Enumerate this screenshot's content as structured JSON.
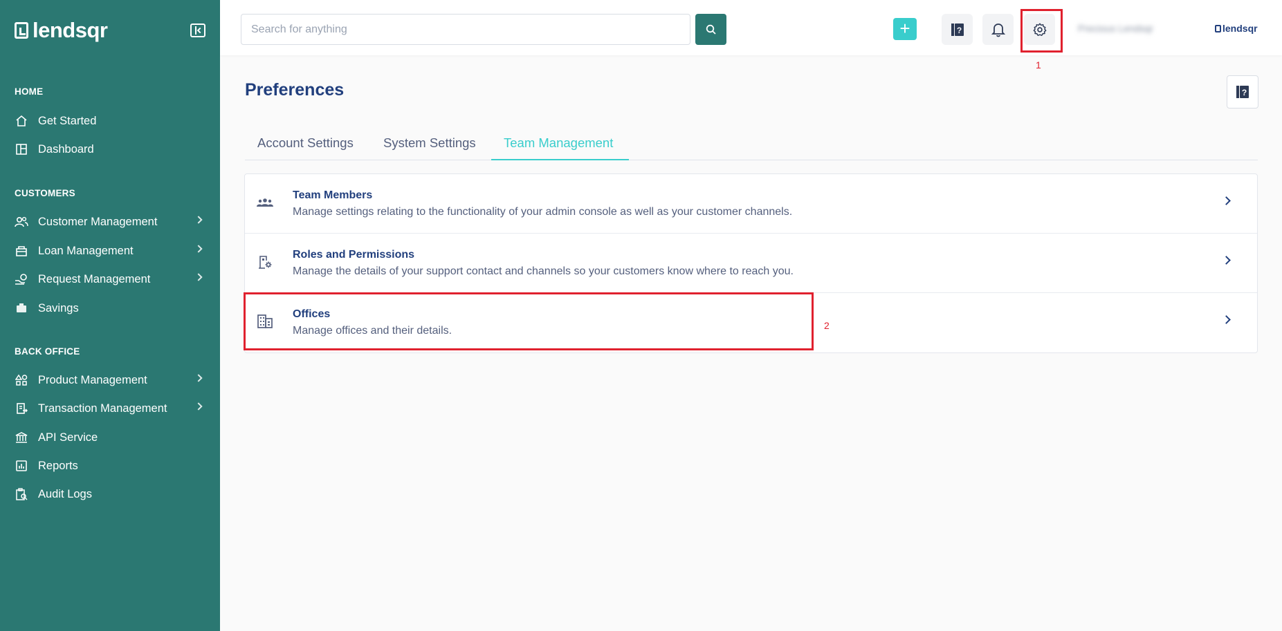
{
  "brand": {
    "logo_text": "lendsqr",
    "small_logo_text": "lendsqr"
  },
  "search": {
    "placeholder": "Search for anything"
  },
  "topbar": {
    "add_label": "+",
    "user_name": "Precious Lendsqr"
  },
  "sidebar": {
    "sections": [
      {
        "title": "HOME",
        "items": [
          {
            "label": "Get Started",
            "icon": "home-icon",
            "has_submenu": false
          },
          {
            "label": "Dashboard",
            "icon": "dashboard-icon",
            "has_submenu": false
          }
        ]
      },
      {
        "title": "CUSTOMERS",
        "items": [
          {
            "label": "Customer Management",
            "icon": "users-icon",
            "has_submenu": true
          },
          {
            "label": "Loan Management",
            "icon": "loan-icon",
            "has_submenu": true
          },
          {
            "label": "Request Management",
            "icon": "request-icon",
            "has_submenu": true
          },
          {
            "label": "Savings",
            "icon": "savings-icon",
            "has_submenu": false
          }
        ]
      },
      {
        "title": "BACK OFFICE",
        "items": [
          {
            "label": "Product Management",
            "icon": "shapes-icon",
            "has_submenu": true
          },
          {
            "label": "Transaction Management",
            "icon": "transaction-icon",
            "has_submenu": true
          },
          {
            "label": "API Service",
            "icon": "bank-icon",
            "has_submenu": false
          },
          {
            "label": "Reports",
            "icon": "chart-icon",
            "has_submenu": false
          },
          {
            "label": "Audit Logs",
            "icon": "clipboard-search-icon",
            "has_submenu": false
          }
        ]
      }
    ]
  },
  "page": {
    "title": "Preferences",
    "tabs": [
      {
        "label": "Account Settings",
        "active": false
      },
      {
        "label": "System Settings",
        "active": false
      },
      {
        "label": "Team Management",
        "active": true
      }
    ],
    "items": [
      {
        "title": "Team Members",
        "description": "Manage settings relating to the functionality of your admin console as well as your customer channels.",
        "icon": "team-icon"
      },
      {
        "title": "Roles and Permissions",
        "description": "Manage the details of your support contact and channels so your customers know where to reach you.",
        "icon": "roles-icon"
      },
      {
        "title": "Offices",
        "description": "Manage offices and their details.",
        "icon": "office-icon"
      }
    ]
  },
  "annotations": [
    {
      "label": "1"
    },
    {
      "label": "2"
    }
  ],
  "colors": {
    "sidebar_bg": "#2b7872",
    "accent": "#39cdcc",
    "primary_text": "#213f7d",
    "annotation": "#e0212e"
  }
}
